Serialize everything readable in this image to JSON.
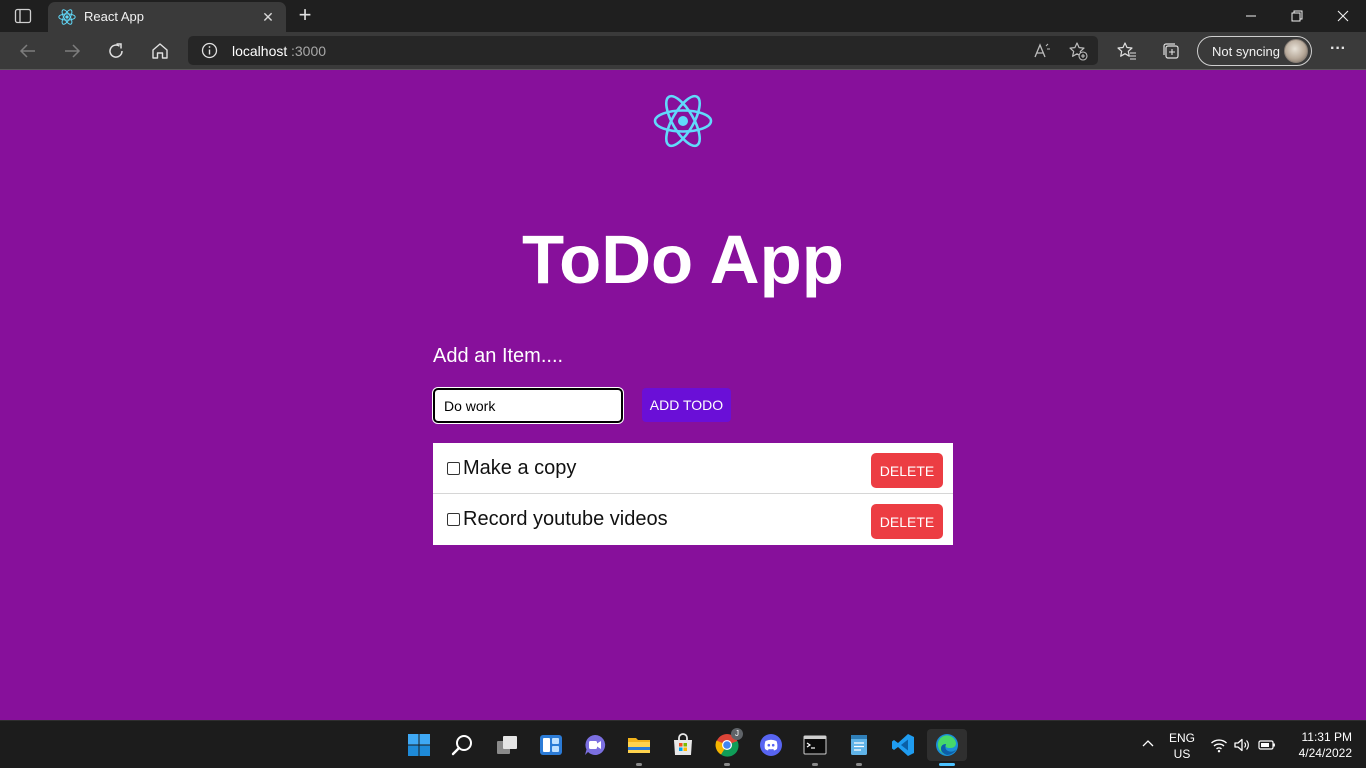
{
  "browser": {
    "tab_title": "React App",
    "url_host": "localhost",
    "url_port": ":3000",
    "sync_label": "Not syncing",
    "more_label": "···"
  },
  "app": {
    "title": "ToDo App",
    "add_label": "Add an Item....",
    "input_value": "Do work",
    "add_button_label": "ADD TODO",
    "todos": [
      {
        "text": "Make a copy",
        "checked": false,
        "delete_label": "DELETE"
      },
      {
        "text": "Record youtube videos",
        "checked": false,
        "delete_label": "DELETE"
      }
    ],
    "colors": {
      "background": "#87109b",
      "add_button": "#6a0fd7",
      "delete_button": "#ec3d43",
      "react_logo": "#61dafb"
    }
  },
  "taskbar": {
    "apps": [
      "start-icon",
      "search-icon",
      "task-view-icon",
      "widgets-icon",
      "chat-icon",
      "file-explorer-icon",
      "store-icon",
      "chrome-icon",
      "discord-icon",
      "terminal-icon",
      "notepad-icon",
      "vscode-icon",
      "edge-icon"
    ],
    "chrome_badge": "J",
    "lang_line1": "ENG",
    "lang_line2": "US",
    "time": "11:31 PM",
    "date": "4/24/2022"
  }
}
